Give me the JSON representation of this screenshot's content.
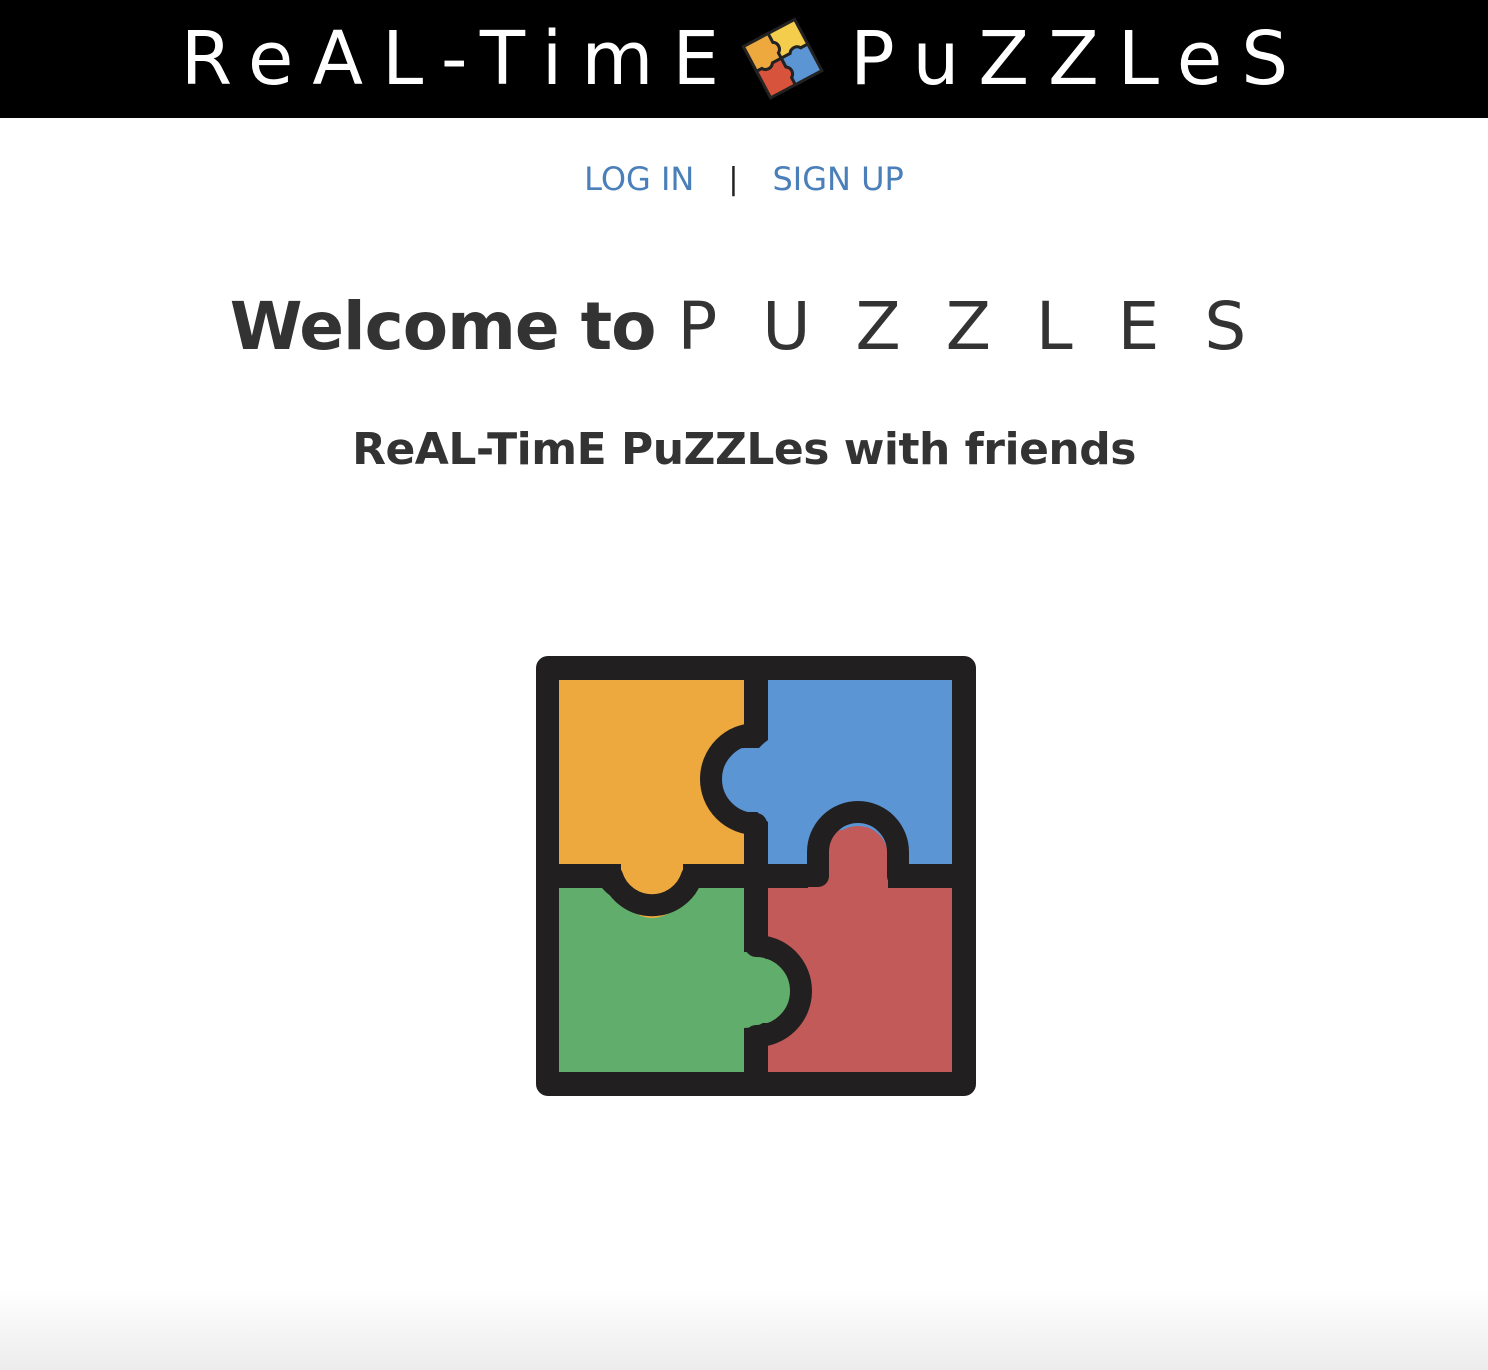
{
  "header": {
    "title_left": "ReAL-TimE",
    "title_right": "PuZZLeS",
    "logo_icon": "puzzle-pieces-icon"
  },
  "nav": {
    "login_label": "LOG IN",
    "separator": "|",
    "signup_label": "SIGN UP",
    "link_color": "#4a7fba"
  },
  "main": {
    "welcome_prefix": "Welcome to",
    "welcome_brand": "P U Z Z L E S",
    "tagline": "ReAL-TimE PuZZLes with friends",
    "hero_icon": "puzzle-four-pieces-icon"
  },
  "colors": {
    "header_bg": "#000000",
    "piece_orange": "#eda93d",
    "piece_blue": "#5b95d4",
    "piece_green": "#61ad6b",
    "piece_red": "#c25a59",
    "outline": "#211f20"
  }
}
